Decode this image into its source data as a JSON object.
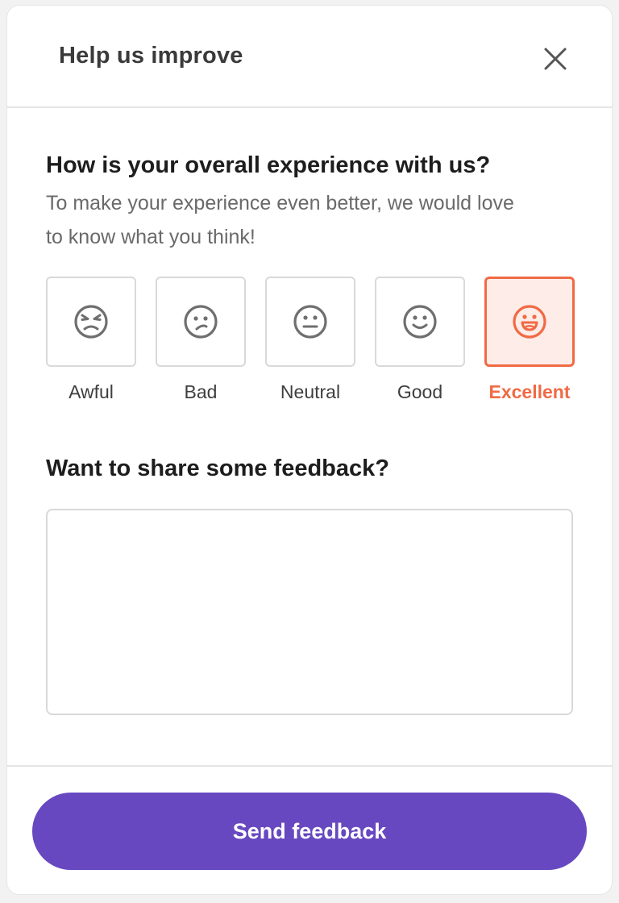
{
  "header": {
    "title": "Help us improve",
    "close_icon": "close-icon"
  },
  "survey": {
    "question": "How is your overall experience with us?",
    "subtitle": "To make your experience even better, we would love to know what you think!",
    "selected_rating": "Excellent",
    "ratings": [
      {
        "label": "Awful",
        "icon": "angry-face-icon",
        "selected": false
      },
      {
        "label": "Bad",
        "icon": "confused-face-icon",
        "selected": false
      },
      {
        "label": "Neutral",
        "icon": "neutral-face-icon",
        "selected": false
      },
      {
        "label": "Good",
        "icon": "smiling-face-icon",
        "selected": false
      },
      {
        "label": "Excellent",
        "icon": "laughing-face-icon",
        "selected": true
      }
    ]
  },
  "feedback": {
    "heading": "Want to share some feedback?",
    "value": "",
    "placeholder": ""
  },
  "footer": {
    "send_label": "Send feedback"
  },
  "colors": {
    "accent": "#f06a45",
    "accent_bg": "#fdece7",
    "primary_button": "#6748c0",
    "icon_gray": "#6f6f6f"
  }
}
